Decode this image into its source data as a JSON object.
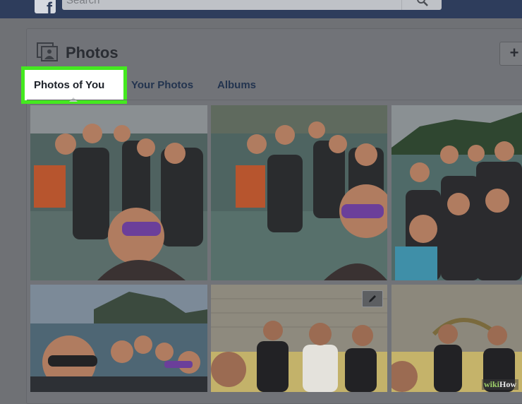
{
  "topbar": {
    "logo_letter": "f",
    "search_placeholder": "Search"
  },
  "section": {
    "title": "Photos",
    "add_button": "+"
  },
  "tabs": [
    {
      "label": "Photos of You",
      "active": true
    },
    {
      "label": "Your Photos",
      "active": false
    },
    {
      "label": "Albums",
      "active": false
    }
  ],
  "photos": [
    {
      "scene": "group-in-water-1"
    },
    {
      "scene": "group-in-water-2"
    },
    {
      "scene": "group-beach-cliffs"
    },
    {
      "scene": "selfie-sea-island"
    },
    {
      "scene": "group-on-couch-edit"
    },
    {
      "scene": "group-on-couch"
    }
  ],
  "icons": {
    "search": "magnifier-icon",
    "photos": "photo-album-icon",
    "edit": "pencil-icon"
  },
  "colors": {
    "highlight": "#44e91f",
    "topbar": "#2e3d5c",
    "tab_text": "#23344f"
  },
  "watermark": {
    "wiki": "wiki",
    "how": "How"
  }
}
